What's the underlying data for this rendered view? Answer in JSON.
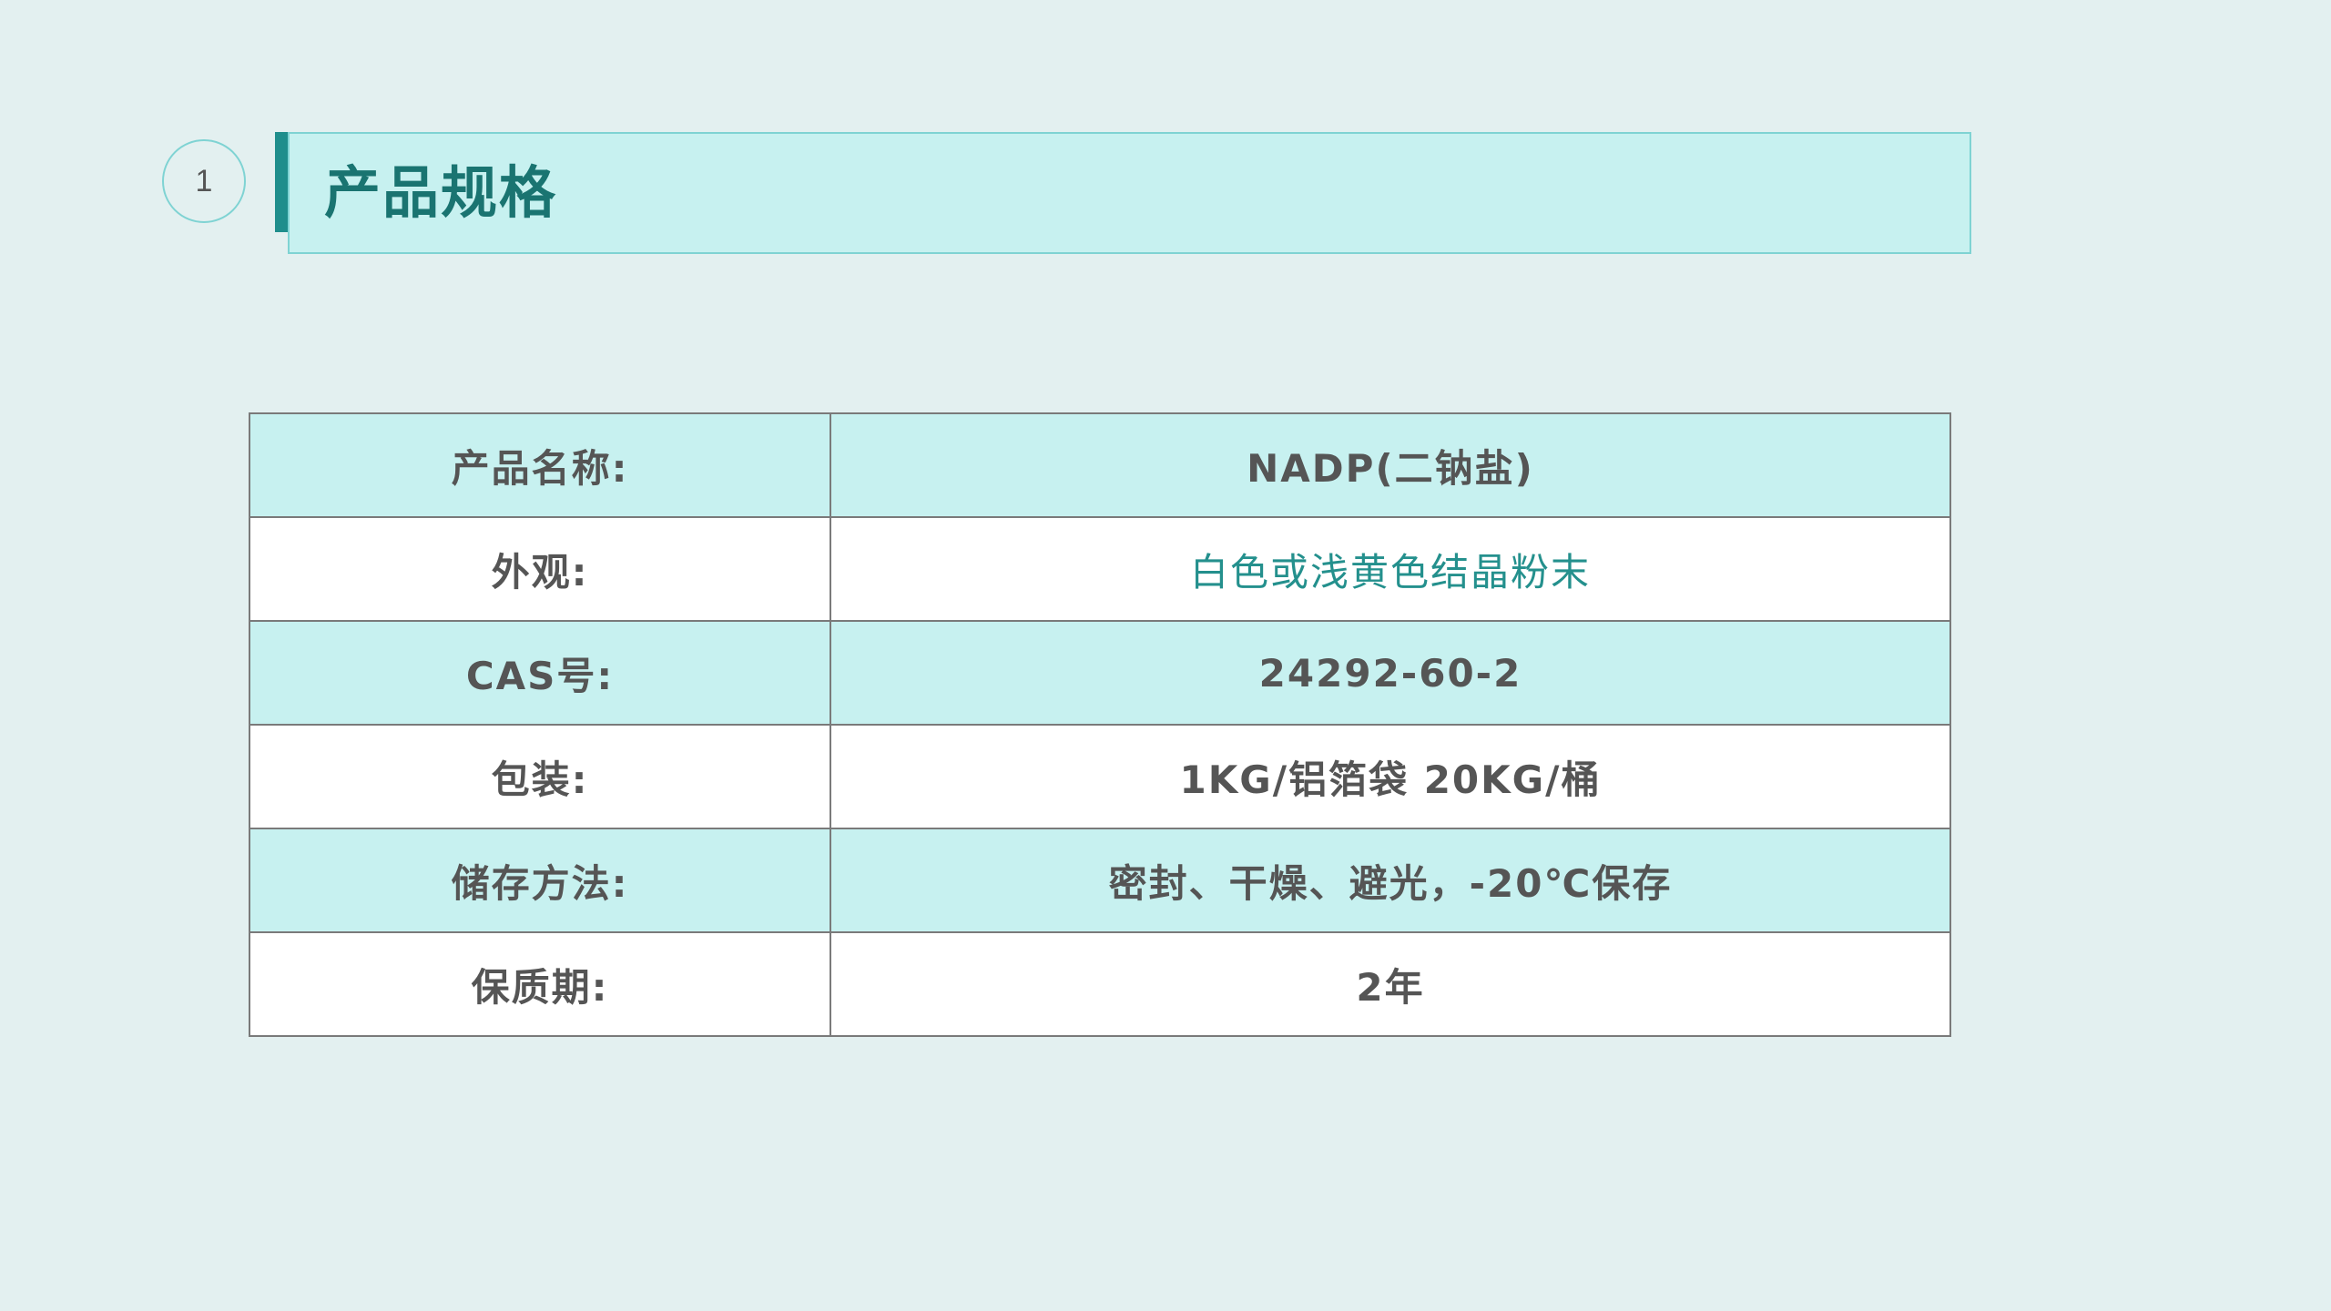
{
  "section": {
    "number": "1",
    "title": "产品规格"
  },
  "spec_table": {
    "rows": [
      {
        "label": "产品名称:",
        "value": "NADP(二钠盐)"
      },
      {
        "label": "外观:",
        "value": "白色或浅黄色结晶粉末"
      },
      {
        "label": "CAS号:",
        "value": "24292-60-2"
      },
      {
        "label": "包装:",
        "value": "1KG/铝箔袋 20KG/桶"
      },
      {
        "label": "储存方法:",
        "value": "密封、干燥、避光，-20℃保存"
      },
      {
        "label": "保质期:",
        "value": "2年"
      }
    ]
  },
  "colors": {
    "background": "#e3f0f0",
    "title_fill": "#c7f1f0",
    "accent": "#1f8e8c",
    "text": "#555555"
  }
}
